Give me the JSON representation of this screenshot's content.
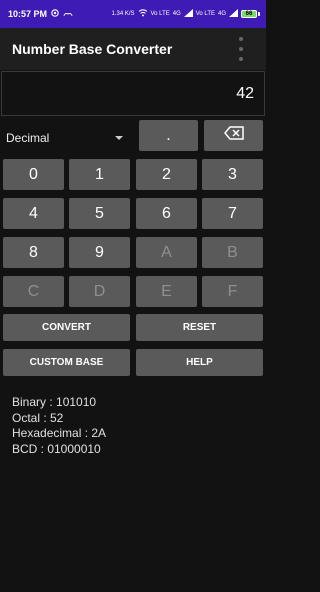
{
  "status": {
    "time": "10:57 PM",
    "net_speed": "1.34 K/S",
    "lte1": "Vo LTE",
    "sig1": "4G",
    "lte2": "Vo LTE",
    "sig2": "4G",
    "battery": "66"
  },
  "app": {
    "title": "Number Base Converter"
  },
  "display": {
    "value": "42"
  },
  "base_select": {
    "value": "Decimal"
  },
  "keys": {
    "dot": ".",
    "row1": [
      "0",
      "1",
      "2",
      "3"
    ],
    "row2": [
      "4",
      "5",
      "6",
      "7"
    ],
    "row3": [
      "8",
      "9",
      "A",
      "B"
    ],
    "row4": [
      "C",
      "D",
      "E",
      "F"
    ]
  },
  "actions": {
    "convert": "CONVERT",
    "reset": "RESET",
    "custom_base": "CUSTOM BASE",
    "help": "HELP"
  },
  "results": {
    "binary": "Binary : 101010",
    "octal": "Octal : 52",
    "hex": "Hexadecimal : 2A",
    "bcd": "BCD : 01000010"
  },
  "colors": {
    "status_bar": "#3f1bb5",
    "app_bar": "#1f1f1f",
    "background": "#121212",
    "button": "#5a5a5a"
  }
}
